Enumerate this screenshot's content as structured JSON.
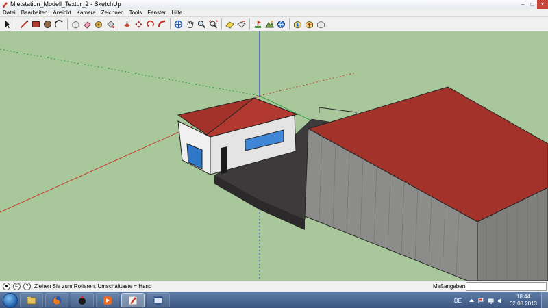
{
  "window": {
    "title": "Mietstation_Modell_Textur_2 - SketchUp",
    "controls": {
      "minimize": "–",
      "maximize": "□",
      "close": "✕"
    }
  },
  "menu": [
    "Datei",
    "Bearbeiten",
    "Ansicht",
    "Kamera",
    "Zeichnen",
    "Tools",
    "Fenster",
    "Hilfe"
  ],
  "toolbar": {
    "groups": [
      [
        "select-tool-icon",
        "line-tool-icon",
        "rectangle-tool-icon",
        "circle-tool-icon",
        "arc-tool-icon"
      ],
      [
        "make-component-icon",
        "eraser-icon",
        "tape-measure-icon",
        "paint-bucket-icon"
      ],
      [
        "push-pull-icon",
        "move-icon",
        "rotate-icon",
        "follow-me-icon"
      ],
      [
        "orbit-icon",
        "pan-icon",
        "zoom-icon",
        "zoom-extents-icon"
      ],
      [
        "previous-view-icon",
        "next-view-icon"
      ],
      [
        "add-location-icon",
        "toggle-terrain-icon",
        "photo-textures-icon"
      ],
      [
        "get-models-icon",
        "share-model-icon",
        "send-to-layout-icon"
      ]
    ]
  },
  "status": {
    "message": "Ziehen Sie zum Rotieren.  Umschalttaste = Hand",
    "measurements_label": "Maßangaben",
    "measurements_value": ""
  },
  "taskbar": {
    "apps": [
      "file-explorer-icon",
      "firefox-icon",
      "media-app-icon",
      "media-player-icon",
      "sketchup-icon",
      "system-window-icon"
    ],
    "active_app": "sketchup-icon",
    "language": "DE",
    "time": "18:44",
    "date": "02.08.2013"
  },
  "colors": {
    "viewport_ground": "#a8c79a",
    "roof": "#a3332a",
    "wall_white": "#eeeeee",
    "hall_wall": "#8c8c8a",
    "pavement": "#3d3a3c",
    "axis_red": "#c83c2c",
    "axis_green": "#2ea03c",
    "axis_blue": "#2a44d8"
  }
}
